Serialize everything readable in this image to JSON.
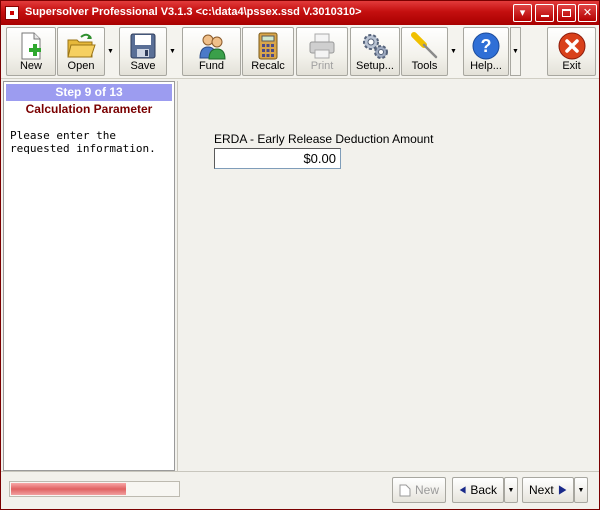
{
  "window": {
    "title": "Supersolver Professional V3.1.3 <c:\\data4\\pssex.ssd V.3010310>"
  },
  "toolbar": {
    "items": [
      {
        "label": "New",
        "icon": "new-document-icon",
        "enabled": true
      },
      {
        "label": "Open",
        "icon": "open-folder-icon",
        "enabled": true
      },
      {
        "label": "Save",
        "icon": "save-disk-icon",
        "enabled": true
      },
      {
        "label": "Fund",
        "icon": "fund-people-icon",
        "enabled": true
      },
      {
        "label": "Recalc",
        "icon": "calculator-icon",
        "enabled": true
      },
      {
        "label": "Print",
        "icon": "printer-icon",
        "enabled": false
      },
      {
        "label": "Setup...",
        "icon": "setup-gears-icon",
        "enabled": true
      },
      {
        "label": "Tools",
        "icon": "screwdriver-icon",
        "enabled": true
      },
      {
        "label": "Help...",
        "icon": "help-icon",
        "enabled": true
      },
      {
        "label": "Exit",
        "icon": "exit-icon",
        "enabled": true
      }
    ]
  },
  "wizard": {
    "step_title": "Step 9 of 13",
    "step_subtitle": "Calculation Parameter",
    "instructions": "Please enter the requested information."
  },
  "form": {
    "erda_label": "ERDA - Early Release Deduction Amount",
    "erda_value": "$0.00"
  },
  "progress": {
    "fraction": 0.69
  },
  "nav": {
    "new_label": "New",
    "back_label": "Back",
    "next_label": "Next"
  },
  "colors": {
    "titlebar": "#c40f0f",
    "step_header": "#9c9cf0",
    "subtitle": "#7a0000",
    "progress_fill": "#e06262"
  }
}
